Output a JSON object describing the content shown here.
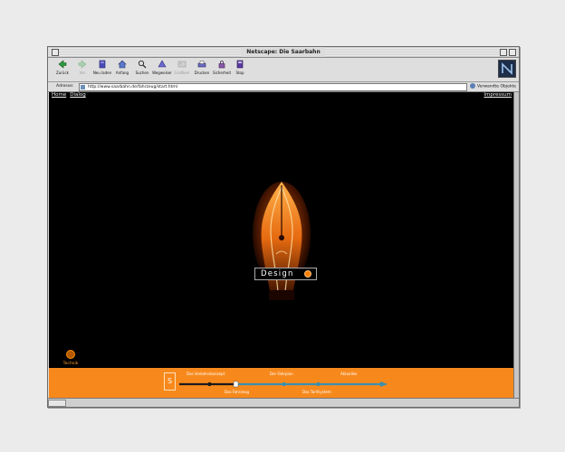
{
  "window": {
    "title": "Netscape: Die Saarbahn"
  },
  "toolbar": {
    "buttons": [
      {
        "label": "Zurück",
        "icon": "back-arrow-icon",
        "enabled": true
      },
      {
        "label": "Vor",
        "icon": "forward-arrow-icon",
        "enabled": false
      },
      {
        "label": "Neu laden",
        "icon": "reload-icon",
        "enabled": true
      },
      {
        "label": "Anfang",
        "icon": "home-icon",
        "enabled": true
      },
      {
        "label": "Suchen",
        "icon": "search-icon",
        "enabled": true
      },
      {
        "label": "Wegweiser",
        "icon": "guide-icon",
        "enabled": true
      },
      {
        "label": "Grafiken",
        "icon": "images-icon",
        "enabled": false
      },
      {
        "label": "Drucken",
        "icon": "print-icon",
        "enabled": true
      },
      {
        "label": "Sicherheit",
        "icon": "security-lock-icon",
        "enabled": true
      },
      {
        "label": "Stop",
        "icon": "stop-icon",
        "enabled": true
      }
    ]
  },
  "address": {
    "label": "Adresse:",
    "url": "http://www.saarbahn.de/fahrzeug/start.html",
    "related_label": "Verwandte Objekte"
  },
  "page": {
    "nav": {
      "home": "Home",
      "dialog": "Dialog",
      "impressum": "Impressum"
    },
    "hero_label": "Design",
    "technik_label": "Technik",
    "timeline": {
      "top_labels": [
        "Das Verkehrskonzept",
        "Der Fahrplan",
        "Aktuelles"
      ],
      "bottom_labels": [
        "Das Fahrzeug",
        "Das Tarifsystem"
      ],
      "logo_letter": "S"
    }
  },
  "colors": {
    "accent_orange": "#f7891c",
    "content_background": "#000000",
    "timeline_line": "#3a8fb0"
  }
}
